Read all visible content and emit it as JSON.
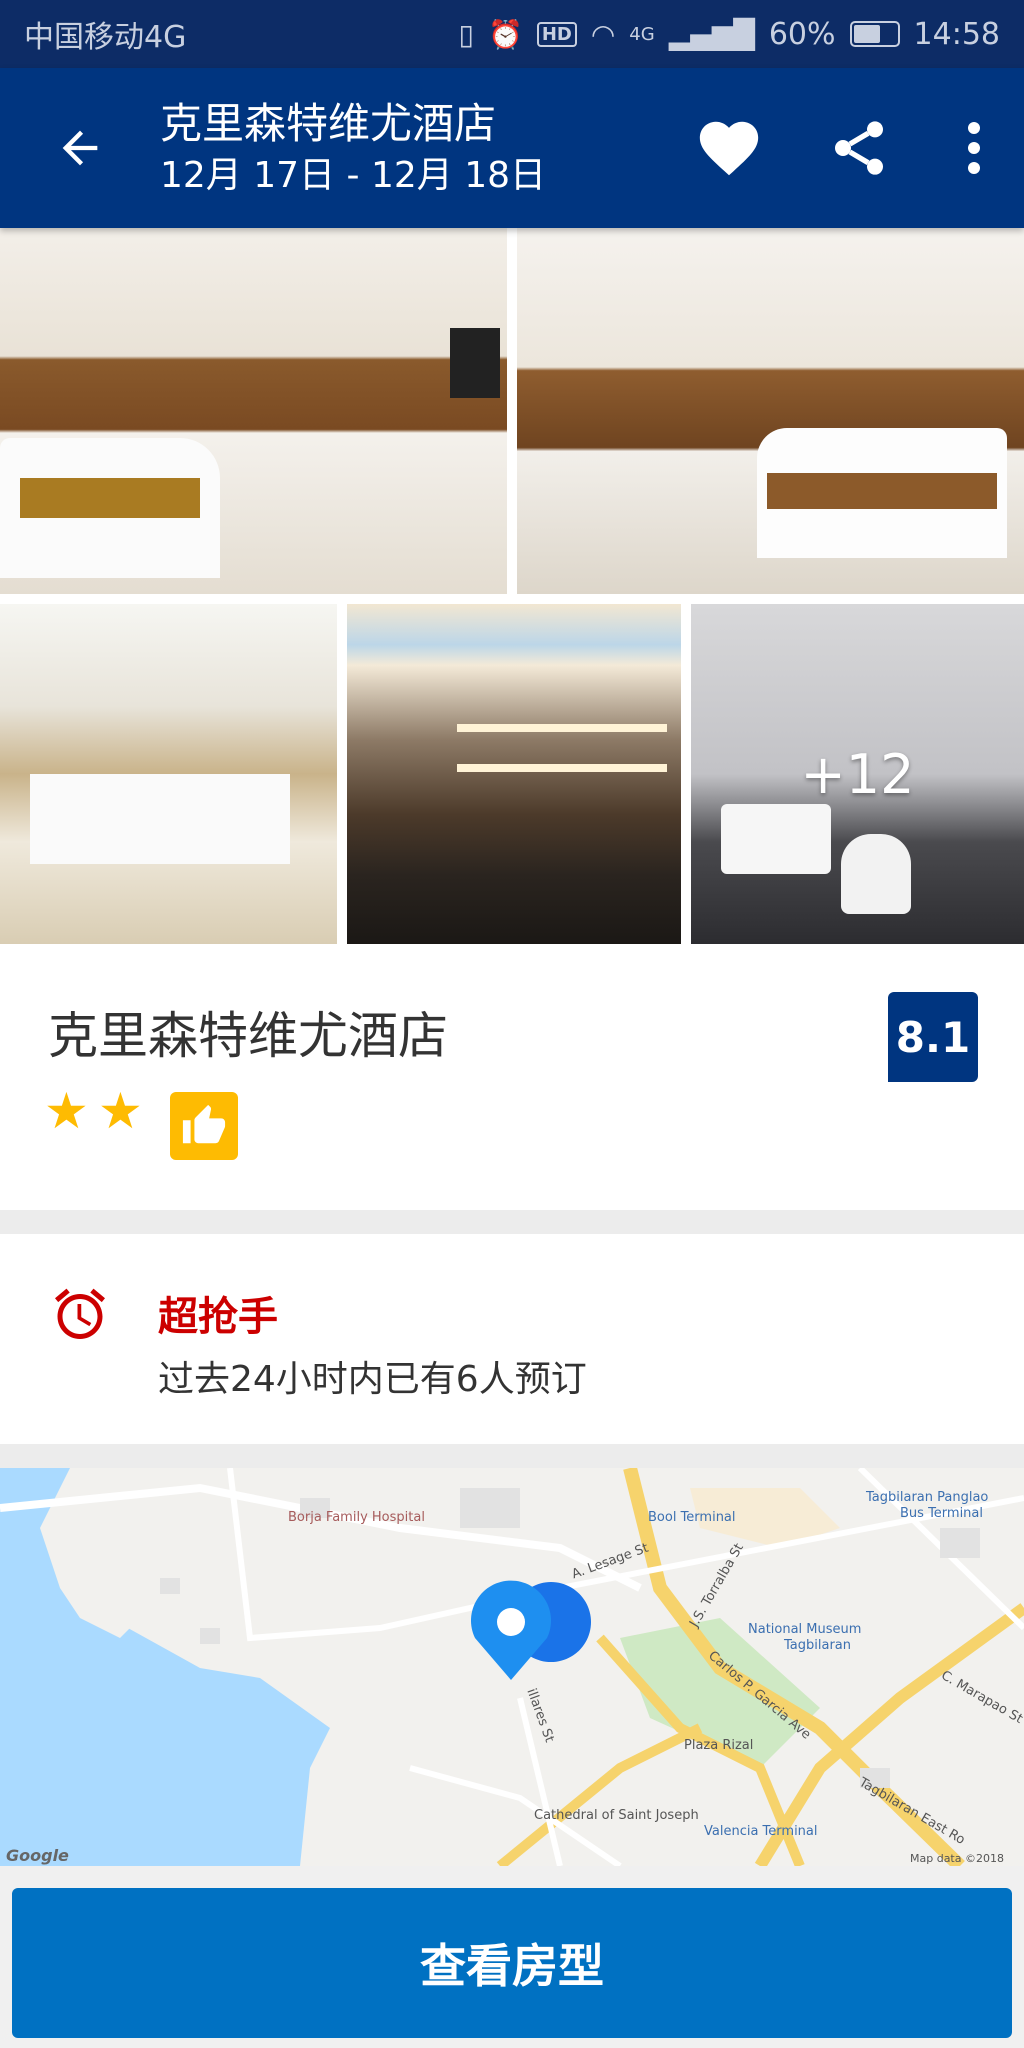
{
  "status_bar": {
    "carrier": "中国移动4G",
    "hd": "HD",
    "network": "4G",
    "battery": "60%",
    "time": "14:58"
  },
  "header": {
    "title": "克里森特维尤酒店",
    "dates": "12月 17日 - 12月 18日",
    "icons": [
      "arrow-left-icon",
      "heart-icon",
      "share-icon",
      "more-vert-icon"
    ]
  },
  "gallery": {
    "more_count": "+12",
    "photos": [
      "room-photo-1",
      "room-photo-2",
      "dining-photo",
      "bar-photo",
      "bathroom-photo"
    ]
  },
  "hotel_info": {
    "name": "克里森特维尤酒店",
    "stars": 2,
    "star_glyph": "★",
    "rating_score": "8.1",
    "brand_color": "#003580",
    "star_color": "#febb02"
  },
  "demand": {
    "title": "超抢手",
    "text": "过去24小时内已有6人预订",
    "accent_color": "#cc0000"
  },
  "map": {
    "labels": {
      "hospital": "Borja Family Hospital",
      "bool_terminal": "Bool Terminal",
      "tagbilaran_bus": "Tagbilaran Panglao",
      "bus_terminal": "Bus Terminal",
      "a_lesage": "A. Lesage St",
      "js_torralba": "J.S. Torralba St",
      "national_museum": "National Museum",
      "museum_city": "Tagbilaran",
      "carlos_garcia": "Carlos P. Garcia Ave",
      "plaza_rizal": "Plaza Rizal",
      "cathedral": "Cathedral of Saint Joseph",
      "valencia": "Valencia Terminal",
      "c_marapao": "C. Marapao St",
      "tagbilaran_east": "Tagbilaran East Ro",
      "hillares": "illares St"
    },
    "google": "Google",
    "attribution": "Map data ©2018 Google"
  },
  "cta": {
    "label": "查看房型",
    "color": "#0071c2"
  }
}
